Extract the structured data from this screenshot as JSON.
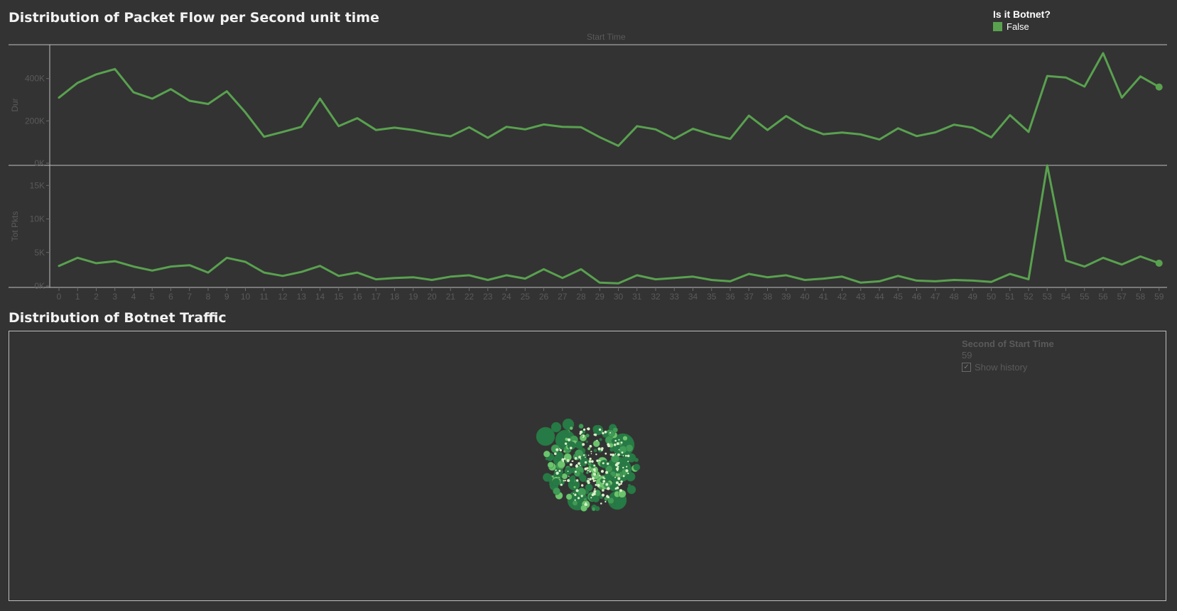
{
  "header": {
    "title": "Distribution of Packet Flow per Second unit time",
    "bottom_title": "Distribution of Botnet Traffic"
  },
  "legend": {
    "title": "Is it Botnet?",
    "items": [
      {
        "label": "False",
        "color": "#59a14f"
      }
    ]
  },
  "page_control": {
    "title": "Second of Start Time",
    "value": "59",
    "show_history_label": "Show history",
    "show_history_checked": true
  },
  "colors": {
    "background": "#333333",
    "line": "#59a14f",
    "bubble_dark": "#267a45",
    "bubble_mid": "#3f9a55",
    "bubble_light": "#6cc46d",
    "bubble_pale": "#d9f0c8"
  },
  "chart_data": [
    {
      "type": "line",
      "title": "Distribution of Packet Flow per Second unit time",
      "xlabel": "Start Time",
      "x": [
        0,
        1,
        2,
        3,
        4,
        5,
        6,
        7,
        8,
        9,
        10,
        11,
        12,
        13,
        14,
        15,
        16,
        17,
        18,
        19,
        20,
        21,
        22,
        23,
        24,
        25,
        26,
        27,
        28,
        29,
        30,
        31,
        32,
        33,
        34,
        35,
        36,
        37,
        38,
        39,
        40,
        41,
        42,
        43,
        44,
        45,
        46,
        47,
        48,
        49,
        50,
        51,
        52,
        53,
        54,
        55,
        56,
        57,
        58,
        59
      ],
      "panels": [
        {
          "ylabel": "Dur",
          "yticks": [
            0,
            200000,
            400000
          ],
          "ytick_labels": [
            "0K",
            "200K",
            "400K"
          ],
          "ylim": [
            0,
            560000
          ],
          "series": [
            {
              "values": [
                310000,
                380000,
                420000,
                445000,
                335000,
                305000,
                350000,
                295000,
                280000,
                340000,
                240000,
                125000,
                148000,
                172000,
                305000,
                175000,
                213000,
                157000,
                168000,
                157000,
                140000,
                127000,
                170000,
                120000,
                172000,
                160000,
                183000,
                172000,
                170000,
                123000,
                82000,
                175000,
                160000,
                115000,
                163000,
                135000,
                115000,
                225000,
                157000,
                223000,
                170000,
                137000,
                145000,
                136000,
                112000,
                165000,
                128000,
                146000,
                182000,
                168000,
                122000,
                227000,
                148000,
                412000,
                405000,
                362000,
                520000,
                310000,
                410000,
                360000
              ]
            }
          ]
        },
        {
          "ylabel": "Tot Pkts",
          "yticks": [
            0,
            5000,
            10000,
            15000
          ],
          "ytick_labels": [
            "0K",
            "5K",
            "10K",
            "15K"
          ],
          "ylim": [
            0,
            18000
          ],
          "series": [
            {
              "values": [
                3000,
                4200,
                3400,
                3700,
                2900,
                2300,
                2900,
                3100,
                2000,
                4200,
                3600,
                2000,
                1500,
                2100,
                3000,
                1500,
                2000,
                1000,
                1200,
                1300,
                900,
                1400,
                1600,
                900,
                1600,
                1100,
                2500,
                1200,
                2500,
                500,
                400,
                1600,
                1000,
                1200,
                1400,
                900,
                700,
                1800,
                1300,
                1600,
                900,
                1100,
                1400,
                500,
                700,
                1500,
                800,
                700,
                900,
                800,
                600,
                1800,
                1000,
                18000,
                3800,
                2900,
                4200,
                3200,
                4400,
                3400
              ]
            }
          ]
        }
      ]
    },
    {
      "type": "bubble",
      "title": "Distribution of Botnet Traffic",
      "legend": [
        "False"
      ]
    }
  ]
}
